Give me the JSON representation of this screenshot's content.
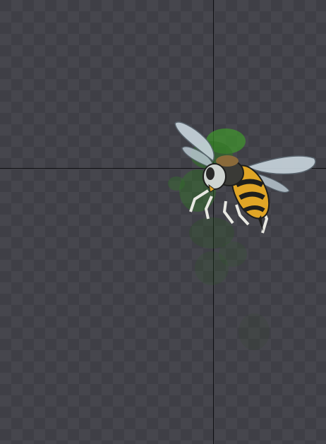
{
  "canvas": {
    "background": "transparency-checkerboard",
    "checker_light": "#46464d",
    "checker_dark": "#3f3f46",
    "guide_color": "#111114"
  },
  "sprite": {
    "subject": "bee-icon",
    "colors": {
      "body_yellow": "#e0a526",
      "body_black": "#1e1e1c",
      "wing": "#c9d6de",
      "wing_edge": "#5a6670",
      "head": "#cfd4d0",
      "pollen_green": "#3f9a2a",
      "legs": "#e8e8e2"
    }
  }
}
